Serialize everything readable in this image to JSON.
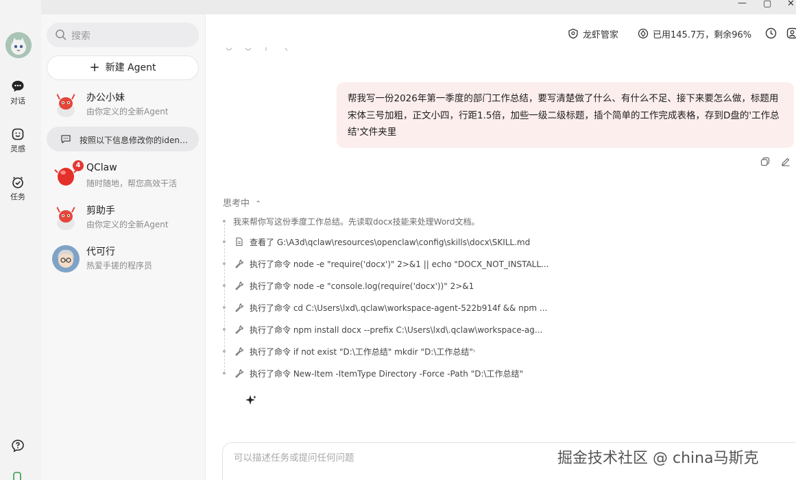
{
  "window": {
    "minimize": "—",
    "maximize": "▢",
    "close": "✕"
  },
  "rail": {
    "items": [
      {
        "label": "对话",
        "icon": "chat-icon"
      },
      {
        "label": "灵感",
        "icon": "smile-icon"
      },
      {
        "label": "任务",
        "icon": "clock-check-icon"
      }
    ],
    "help_icon": "help-icon"
  },
  "list": {
    "search_placeholder": "搜索",
    "new_agent_label": "新建 Agent",
    "conversations": [
      {
        "name": "办公小妹",
        "subtitle": "由你定义的全新Agent"
      },
      {
        "name": "QClaw",
        "subtitle": "随时随地，帮您高效干活",
        "badge": "4"
      },
      {
        "name": "剪助手",
        "subtitle": "由你定义的全新Agent"
      },
      {
        "name": "代可行",
        "subtitle": "热爱手搓的程序员"
      }
    ],
    "sub_item": "按照以下信息修改你的iden…"
  },
  "header": {
    "steward_label": "龙虾管家",
    "usage_label": "已用145.7万，剩余96%"
  },
  "chat": {
    "user_message": "帮我写一份2026年第一季度的部门工作总结，要写清楚做了什么、有什么不足、接下来要怎么做，标题用宋体三号加粗，正文小四，行距1.5倍，加些一级二级标题，插个简单的工作完成表格，存到D盘的'工作总结'文件夹里",
    "thinking_title": "思考中",
    "thinking_intro": "我来帮你写这份季度工作总结。先读取docx技能来处理Word文档。",
    "steps": [
      {
        "icon": "file-icon",
        "text": "查看了 G:\\A3d\\qclaw\\resources\\openclaw\\config\\skills\\docx\\SKILL.md"
      },
      {
        "icon": "wrench-icon",
        "text": "执行了命令 node -e \"require('docx')\" 2>&1 || echo \"DOCX_NOT_INSTALL..."
      },
      {
        "icon": "wrench-icon",
        "text": "执行了命令 node -e \"console.log(require('docx'))\" 2>&1"
      },
      {
        "icon": "wrench-icon",
        "text": "执行了命令 cd C:\\Users\\lxd\\.qclaw\\workspace-agent-522b914f && npm ..."
      },
      {
        "icon": "wrench-icon",
        "text": "执行了命令 npm install docx --prefix C:\\Users\\lxd\\.qclaw\\workspace-ag..."
      },
      {
        "icon": "wrench-icon",
        "text": "执行了命令 if not exist \"D:\\工作总结\" mkdir \"D:\\工作总结\""
      },
      {
        "icon": "wrench-icon",
        "text": "执行了命令 New-Item -ItemType Directory -Force -Path \"D:\\工作总结\""
      }
    ]
  },
  "composer": {
    "placeholder": "可以描述任务或提问任何问题"
  },
  "watermark": "掘金技术社区 @ china马斯克"
}
